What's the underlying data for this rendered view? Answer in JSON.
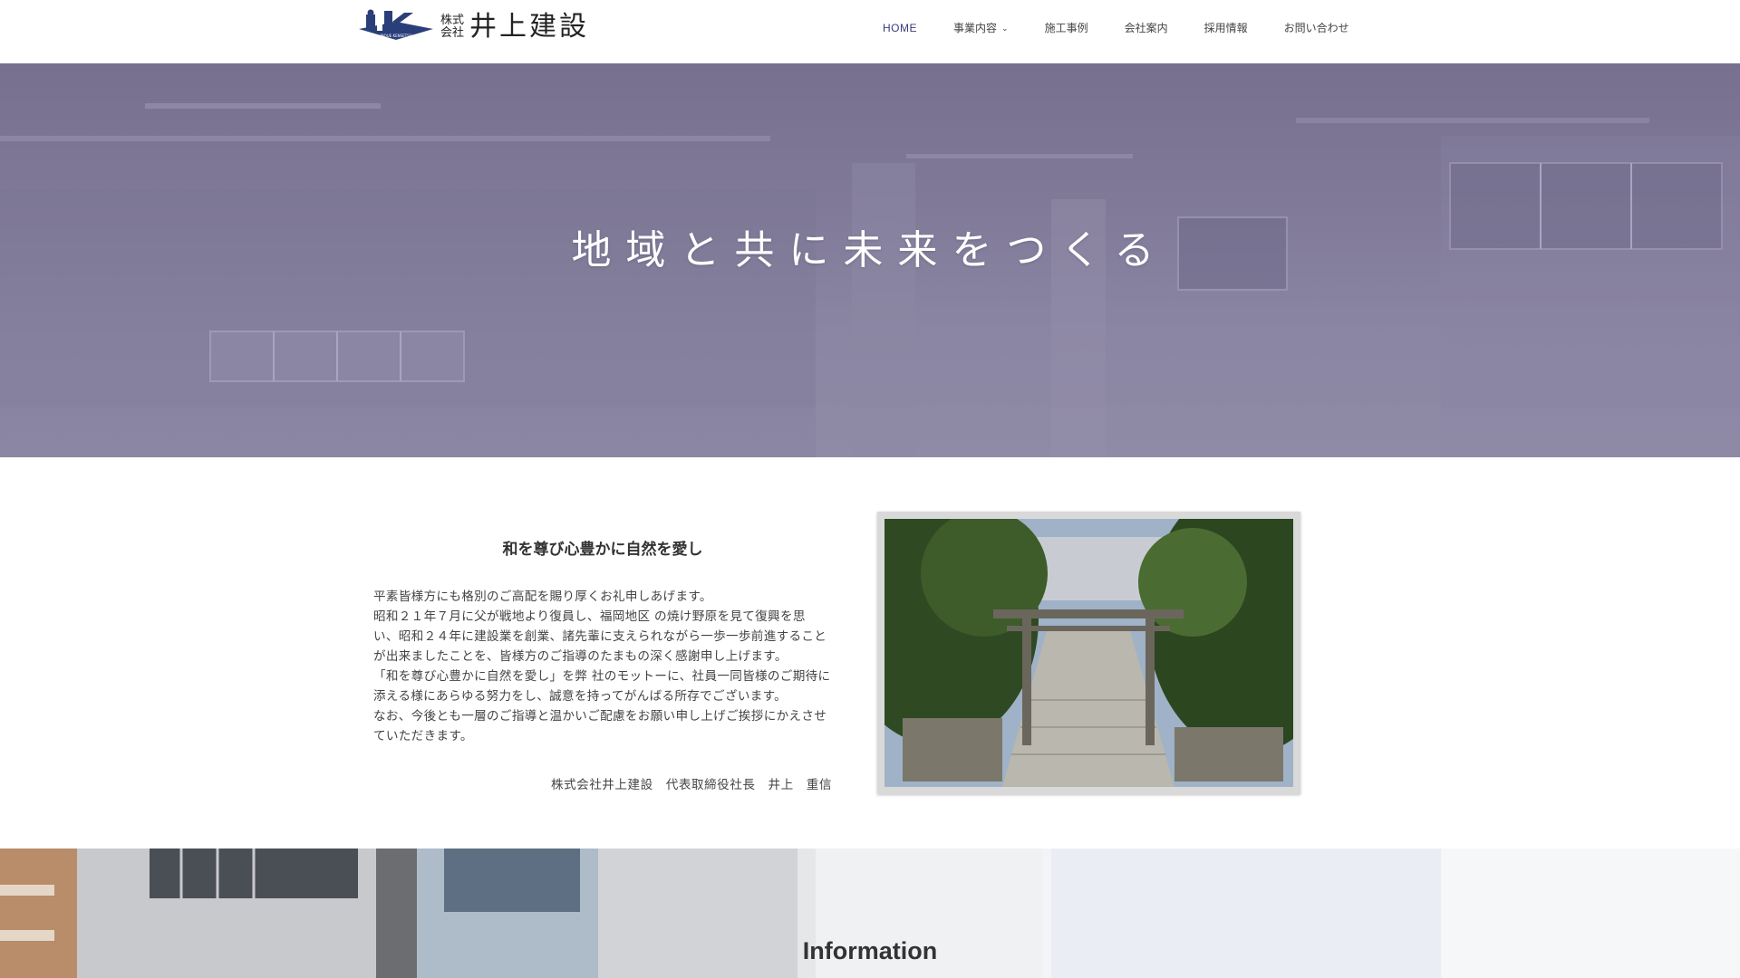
{
  "brand": {
    "mark_text": "ik",
    "mark_subtext": "INOUE KENSETSU",
    "small_top": "株式",
    "small_bottom": "会社",
    "name": "井上建設"
  },
  "nav": {
    "items": [
      {
        "label": "HOME",
        "active": true
      },
      {
        "label": "事業内容",
        "has_dropdown": true
      },
      {
        "label": "施工事例"
      },
      {
        "label": "会社案内"
      },
      {
        "label": "採用情報"
      },
      {
        "label": "お問い合わせ"
      }
    ]
  },
  "hero": {
    "title": "地域と共に未来をつくる"
  },
  "greeting": {
    "heading": "和を尊び心豊かに自然を愛し",
    "lines": [
      "平素皆様方にも格別のご高配を賜り厚くお礼申しあげます。",
      "昭和２１年７月に父が戦地より復員し、福岡地区 の焼け野原を見て復興を思",
      "い、昭和２４年に建設業を創業、諸先輩に支えられながら一歩一歩前進すること",
      "が出来ましたことを、皆様方のご指導のたまもの深く感謝申し上げます。",
      "「和を尊び心豊かに自然を愛し」を弊 社のモットーに、社員一同皆様のご期待に",
      "添える様にあらゆる努力をし、誠意を持ってがんばる所存でございます。",
      "なお、今後とも一層のご指導と温かいご配慮をお願い申し上げご挨拶にかえさせ",
      "ていただきます。"
    ],
    "signature": "株式会社井上建設　代表取締役社長　井上　重信"
  },
  "info": {
    "title": "Information"
  },
  "colors": {
    "accent": "#3c3a7a",
    "hero_overlay": "#7f7998",
    "logo_blue": "#2a3f7a"
  }
}
